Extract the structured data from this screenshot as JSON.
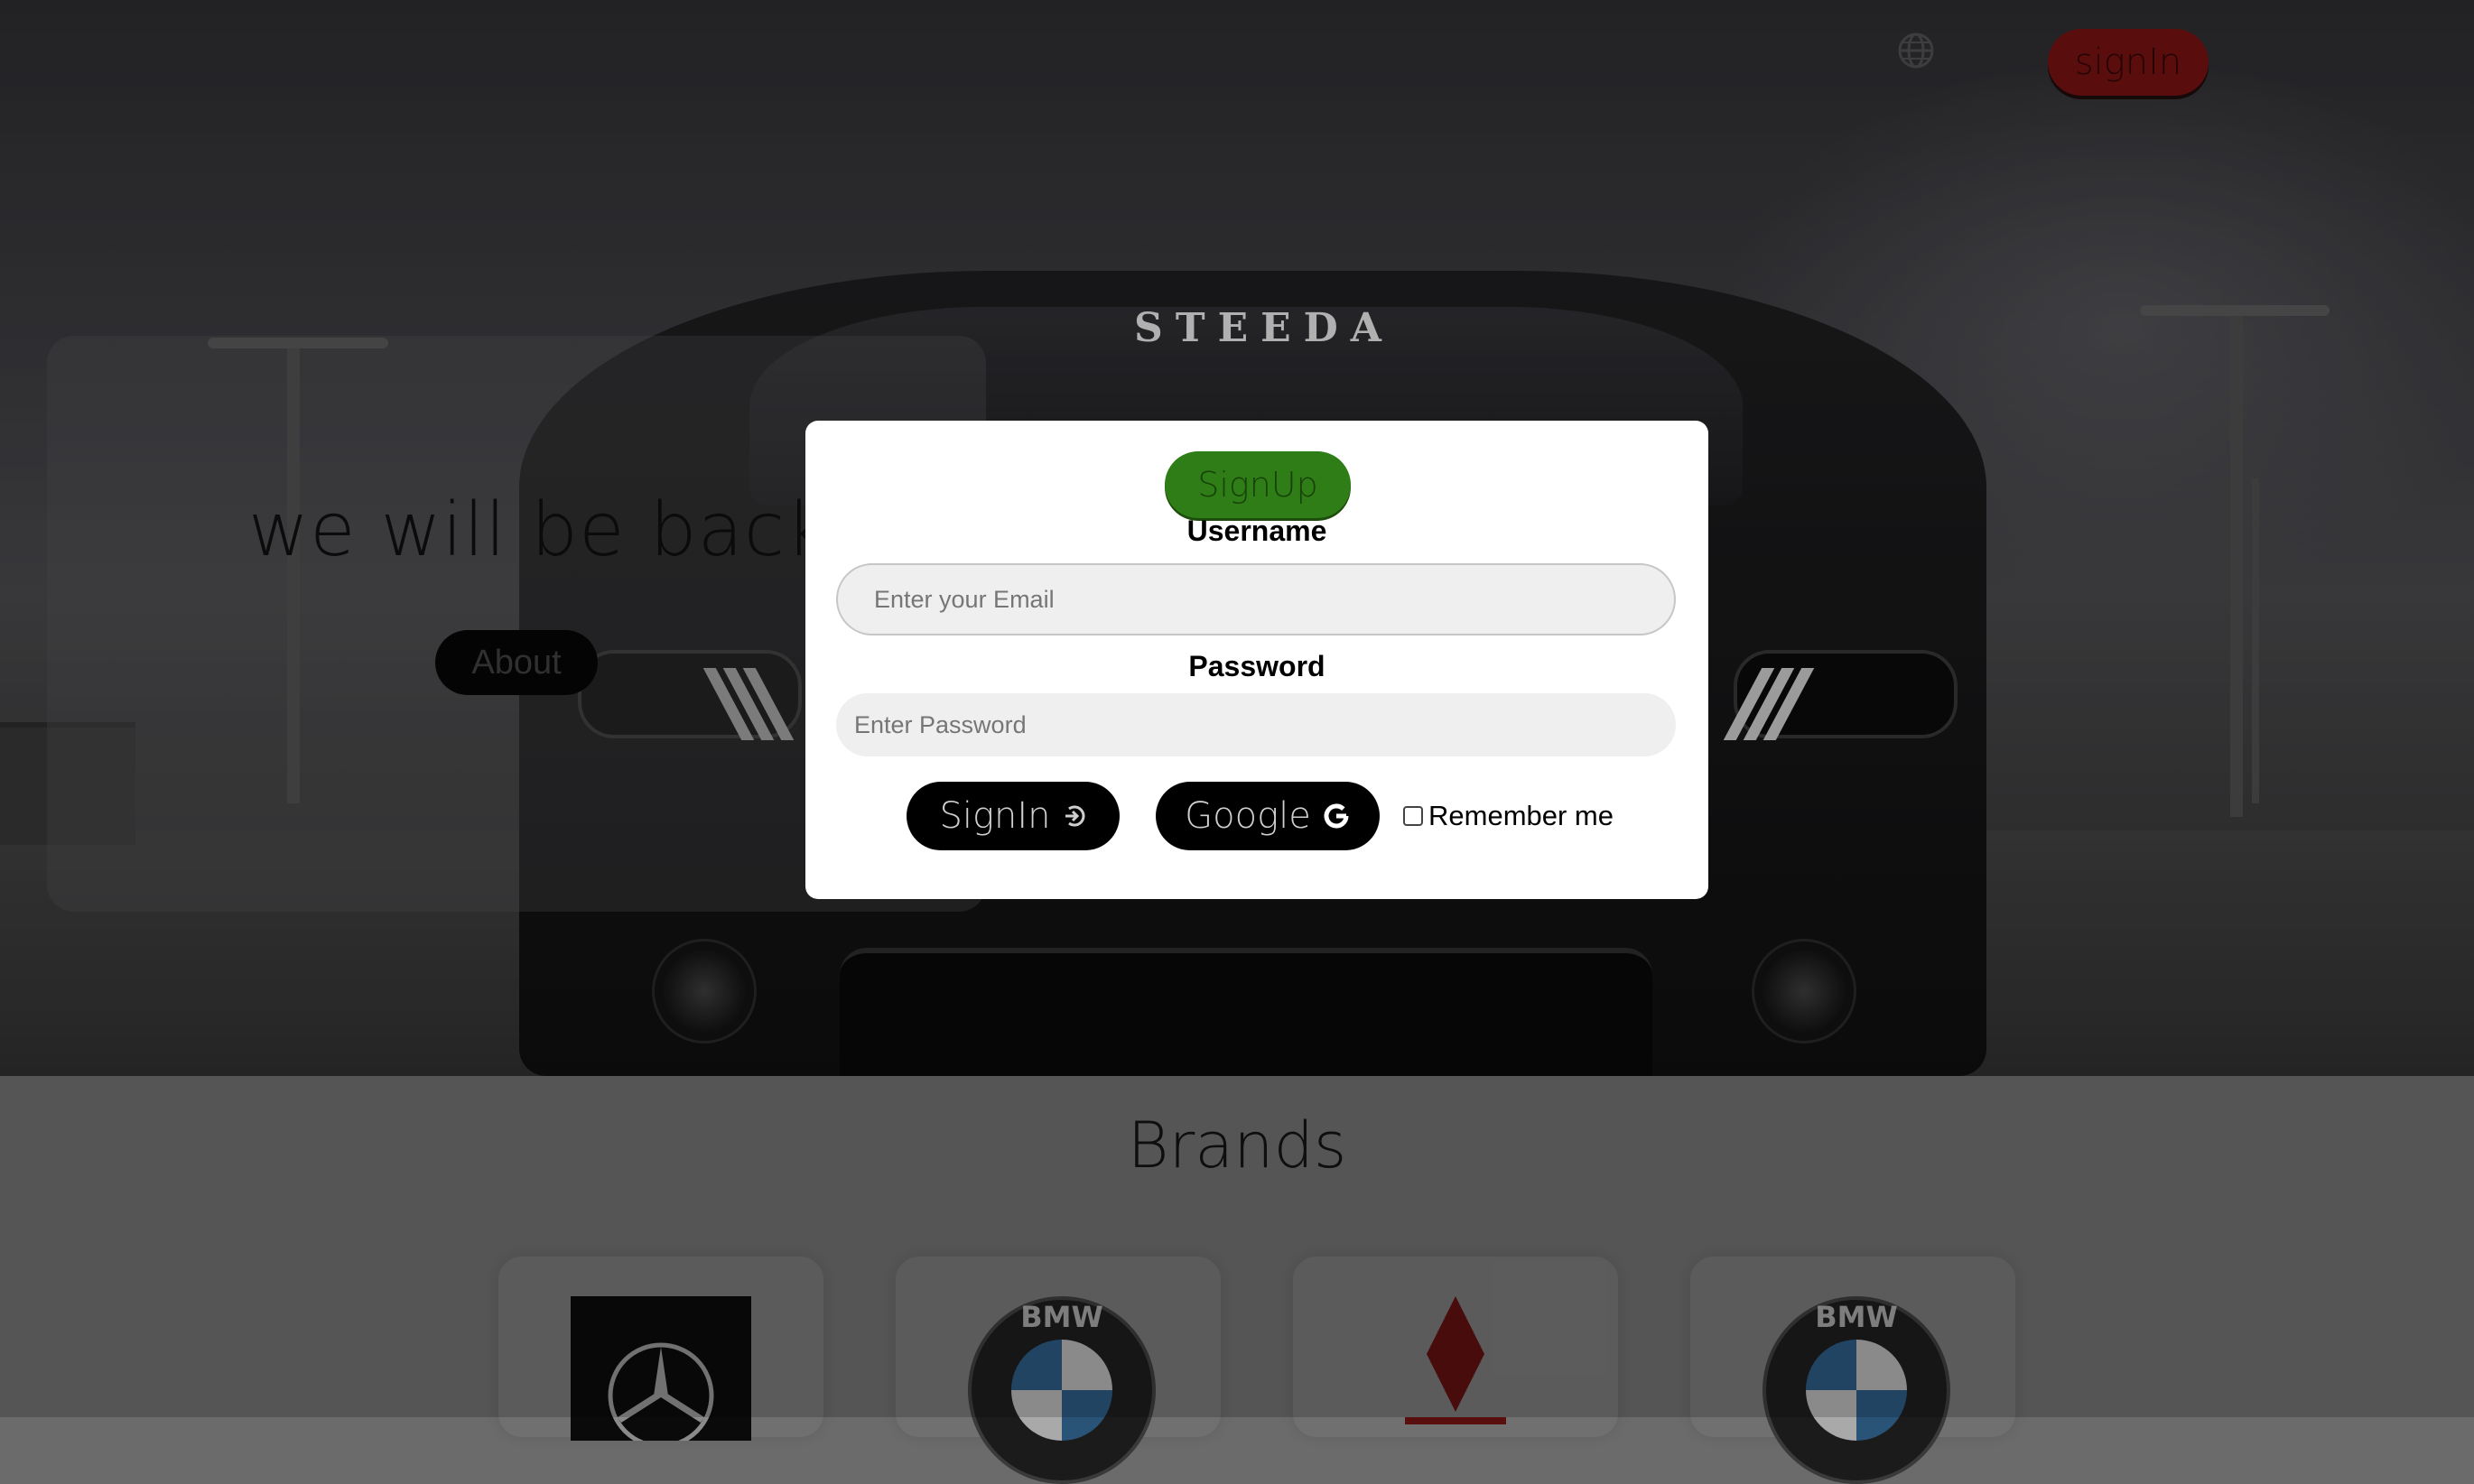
{
  "header": {
    "globe_icon": "globe-icon",
    "signin_label": "signIn"
  },
  "hero": {
    "windshield_text": "STEEDA",
    "title": "we will be back",
    "about_label": "About"
  },
  "brands": {
    "title": "Brands",
    "items": [
      {
        "logo": "mercedes-logo"
      },
      {
        "logo": "bmw-logo",
        "letters": "BMW"
      },
      {
        "logo": "mitsubishi-logo"
      },
      {
        "logo": "bmw-logo",
        "letters": "BMW"
      }
    ]
  },
  "modal": {
    "signup_label": "SignUp",
    "username_label": "Username",
    "email_placeholder": "Enter your Email",
    "password_label": "Password",
    "password_placeholder": "Enter Password",
    "signin_label": "SignIn",
    "google_label": "Google",
    "remember_label": "Remember me",
    "remember_checked": false
  },
  "colors": {
    "signup_green": "#2f7d16",
    "signin_red": "#6e1111",
    "modal_bg": "#ffffff",
    "button_dark": "#000000"
  }
}
